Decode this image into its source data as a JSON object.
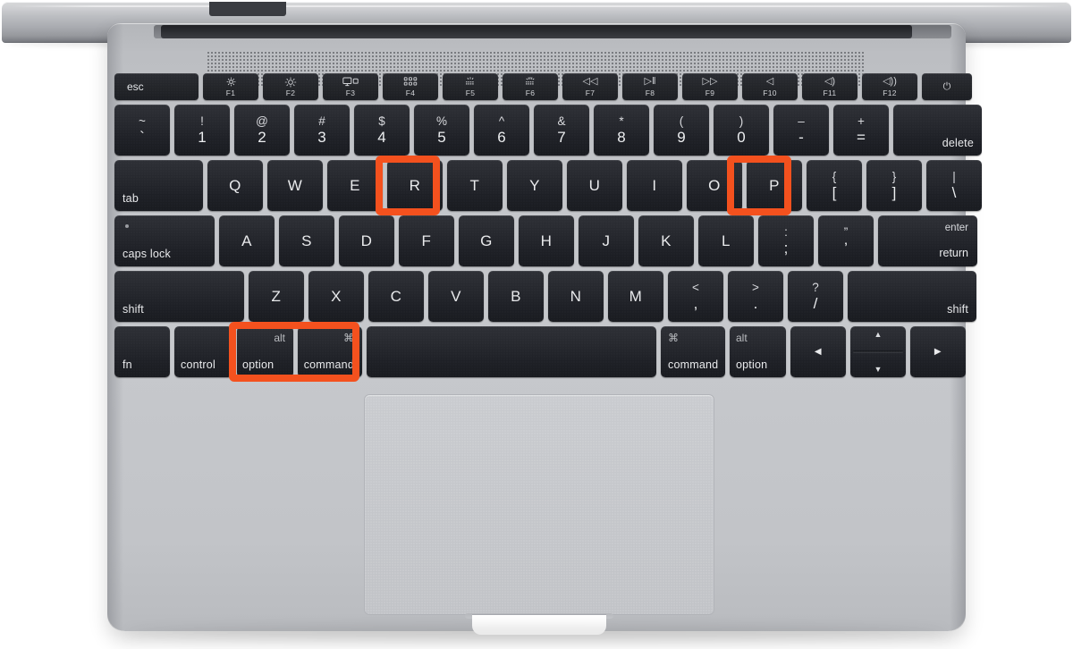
{
  "device": {
    "name": "MacBook keyboard diagram",
    "body_color": "#c4c6ca",
    "key_color": "#25272c",
    "highlight_color": "#f4511e"
  },
  "keyboard": {
    "function_row": [
      {
        "name": "esc",
        "label": "esc",
        "glyph": "",
        "fn": ""
      },
      {
        "name": "f1",
        "label": "",
        "glyph": "brightness-down-icon",
        "fn": "F1"
      },
      {
        "name": "f2",
        "label": "",
        "glyph": "brightness-up-icon",
        "fn": "F2"
      },
      {
        "name": "f3",
        "label": "",
        "glyph": "mission-control-icon",
        "fn": "F3"
      },
      {
        "name": "f4",
        "label": "",
        "glyph": "launchpad-icon",
        "fn": "F4"
      },
      {
        "name": "f5",
        "label": "",
        "glyph": "keyboard-brightness-down-icon",
        "fn": "F5"
      },
      {
        "name": "f6",
        "label": "",
        "glyph": "keyboard-brightness-up-icon",
        "fn": "F6"
      },
      {
        "name": "f7",
        "label": "",
        "glyph": "◁◁",
        "fn": "F7"
      },
      {
        "name": "f8",
        "label": "",
        "glyph": "▷‖",
        "fn": "F8"
      },
      {
        "name": "f9",
        "label": "",
        "glyph": "▷▷",
        "fn": "F9"
      },
      {
        "name": "f10",
        "label": "",
        "glyph": "◁",
        "fn": "F10"
      },
      {
        "name": "f11",
        "label": "",
        "glyph": "◁)",
        "fn": "F11"
      },
      {
        "name": "f12",
        "label": "",
        "glyph": "◁))",
        "fn": "F12"
      },
      {
        "name": "power",
        "label": "",
        "glyph": "⏻",
        "fn": ""
      }
    ],
    "number_row": [
      {
        "name": "backtick",
        "top": "~",
        "bottom": "`"
      },
      {
        "name": "1",
        "top": "!",
        "bottom": "1"
      },
      {
        "name": "2",
        "top": "@",
        "bottom": "2"
      },
      {
        "name": "3",
        "top": "#",
        "bottom": "3"
      },
      {
        "name": "4",
        "top": "$",
        "bottom": "4"
      },
      {
        "name": "5",
        "top": "%",
        "bottom": "5"
      },
      {
        "name": "6",
        "top": "^",
        "bottom": "6"
      },
      {
        "name": "7",
        "top": "&",
        "bottom": "7"
      },
      {
        "name": "8",
        "top": "*",
        "bottom": "8"
      },
      {
        "name": "9",
        "top": "(",
        "bottom": "9"
      },
      {
        "name": "0",
        "top": ")",
        "bottom": "0"
      },
      {
        "name": "minus",
        "top": "–",
        "bottom": "-"
      },
      {
        "name": "equals",
        "top": "+",
        "bottom": "="
      },
      {
        "name": "delete",
        "label": "delete"
      }
    ],
    "qwerty_row": {
      "tab": "tab",
      "keys": [
        "Q",
        "W",
        "E",
        "R",
        "T",
        "Y",
        "U",
        "I",
        "O",
        "P"
      ],
      "bracket_left": {
        "top": "{",
        "bottom": "["
      },
      "bracket_right": {
        "top": "}",
        "bottom": "]"
      },
      "backslash": {
        "top": "|",
        "bottom": "\\"
      }
    },
    "home_row": {
      "caps_lock": "caps lock",
      "keys": [
        "A",
        "S",
        "D",
        "F",
        "G",
        "H",
        "J",
        "K",
        "L"
      ],
      "semicolon": {
        "top": ":",
        "bottom": ";"
      },
      "quote": {
        "top": "”",
        "bottom": "’"
      },
      "return_top": "enter",
      "return_bottom": "return"
    },
    "shift_row": {
      "shift_left": "shift",
      "keys": [
        "Z",
        "X",
        "C",
        "V",
        "B",
        "N",
        "M"
      ],
      "comma": {
        "top": "<",
        "bottom": ","
      },
      "period": {
        "top": ">",
        "bottom": "."
      },
      "slash": {
        "top": "?",
        "bottom": "/"
      },
      "shift_right": "shift"
    },
    "bottom_row": {
      "fn": "fn",
      "control": "control",
      "option_left": {
        "top": "alt",
        "bottom": "option"
      },
      "command_left": {
        "top": "⌘",
        "bottom": "command"
      },
      "space": "",
      "command_right": {
        "top": "⌘",
        "bottom": "command"
      },
      "option_right": {
        "top": "alt",
        "bottom": "option"
      },
      "arrow_left": "◀",
      "arrow_up": "▲",
      "arrow_down": "▼",
      "arrow_right": "▶"
    }
  },
  "highlights": [
    {
      "name": "highlight-r-key",
      "target": "R"
    },
    {
      "name": "highlight-p-key",
      "target": "P"
    },
    {
      "name": "highlight-option-command",
      "target": "option + command"
    }
  ]
}
